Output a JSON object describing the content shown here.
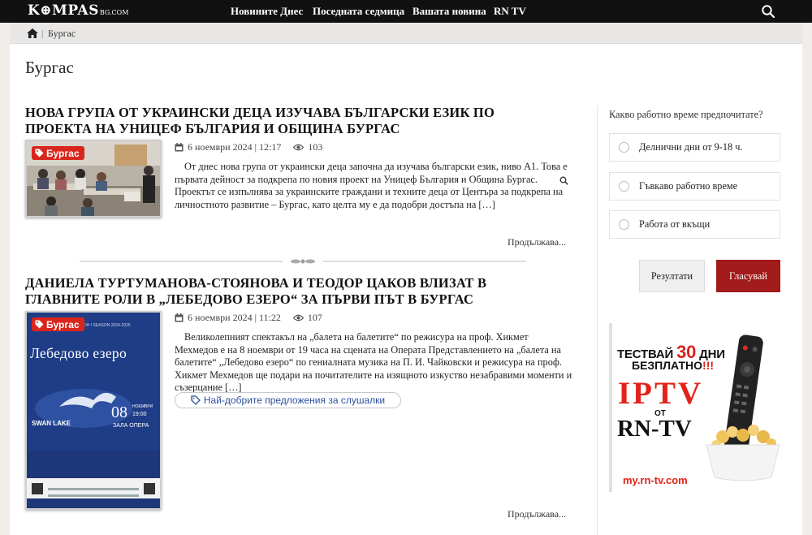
{
  "site": {
    "logo_main": "K⊕MPAS",
    "logo_suffix": "BG.COM"
  },
  "nav": {
    "items": [
      "Новините Днес",
      "Поседната седмица",
      "Вашата новина",
      "RN TV"
    ]
  },
  "breadcrumb": {
    "separator": "|",
    "current": "Бургас"
  },
  "page": {
    "title": "Бургас"
  },
  "articles": [
    {
      "title": "Нова група от украински деца изучава български език по проекта на УНИЦЕФ България и Община Бургас",
      "tag": "Бургас",
      "date": "6 ноември 2024 | 12:17",
      "views": "103",
      "excerpt": "От днес нова група от украински деца започна да изучава български език, ниво А1. Това е първата дейност за подкрепа по новия проект на Уницеф България и Община Бургас. Проектът се изпълнява за украинските граждани и техните деца от Центъра за подкрепа на личностното развитие – Бургас, като целта му е да подобри достъпа на […]",
      "more": "Продължава..."
    },
    {
      "title": "Даниела Туртуманова-Стоянова и Теодор Цаков влизат в главните роли в „Лебедово езеро“ за първи път в Бургас",
      "tag": "Бургас",
      "date": "6 ноември 2024 | 11:22",
      "views": "107",
      "excerpt": "Великолепният спектакъл на „балета на балетите“ по режисура на проф. Хикмет Мехмедов е на 8 ноември от 19 часа на сцената на Операта   Представлението на „балета на балетите“ „Лебедово езеро“ по гениалната музика на П. И. Чайковски и режисура на проф. Хикмет Мехмедов ще подари на почитателите на изящното изкуство незабравими моменти и съзерцание […]",
      "more": "Продължава...",
      "poster": {
        "header": "СЕЗОН I SEASON 2024-2025",
        "title": "Лебедово езеро",
        "swan_lake": "SWAN LAKE",
        "day": "08",
        "month": "НОЕМВРИ",
        "time": "19:00",
        "venue": "ЗАЛА ОПЕРА"
      }
    }
  ],
  "ad_pill": {
    "label": "Най-добрите предложения за слушалки"
  },
  "poll": {
    "question": "Какво работно време предпочитате?",
    "options": [
      "Делнични дни от 9-18 ч.",
      "Гъвкаво работно време",
      "Работа от вкъщи"
    ],
    "results_label": "Резултати",
    "vote_label": "Гласувай"
  },
  "banner": {
    "line1_a": "ТЕСТВАЙ",
    "line1_num": "30",
    "line1_b": "ДНИ",
    "line2_a": "БЕЗПЛАТНО",
    "line2_b": "!!!",
    "iptv": "IPTV",
    "ot": "ОТ",
    "rntv": "RN-TV",
    "url": "my.rn-tv.com"
  },
  "colors": {
    "topbar": "#111111",
    "accent_red": "#d9261c",
    "vote_button": "#a11b1b",
    "page_bg": "#f1ede8"
  }
}
